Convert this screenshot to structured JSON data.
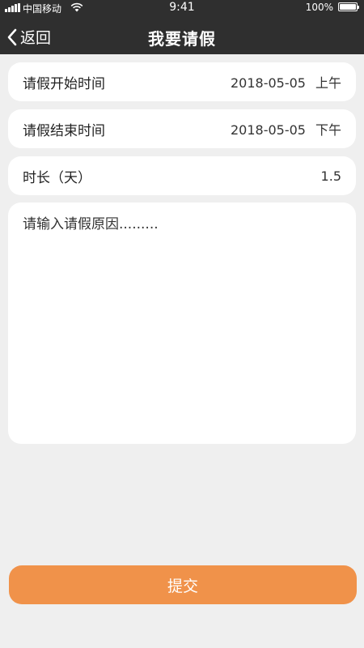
{
  "status_bar": {
    "carrier": "中国移动",
    "time": "9:41",
    "battery": "100%"
  },
  "nav": {
    "back_label": "返回",
    "title": "我要请假"
  },
  "form": {
    "start": {
      "label": "请假开始时间",
      "date": "2018-05-05",
      "period": "上午"
    },
    "end": {
      "label": "请假结束时间",
      "date": "2018-05-05",
      "period": "下午"
    },
    "duration": {
      "label": "时长（天）",
      "value": "1.5"
    },
    "reason_placeholder": "请输入请假原因.........",
    "submit_label": "提交"
  },
  "colors": {
    "header_bg": "#2f2f2f",
    "page_bg": "#efefef",
    "accent": "#f0924a"
  },
  "icons": [
    "signal-icon",
    "wifi-icon",
    "battery-icon",
    "back-chevron-icon"
  ]
}
